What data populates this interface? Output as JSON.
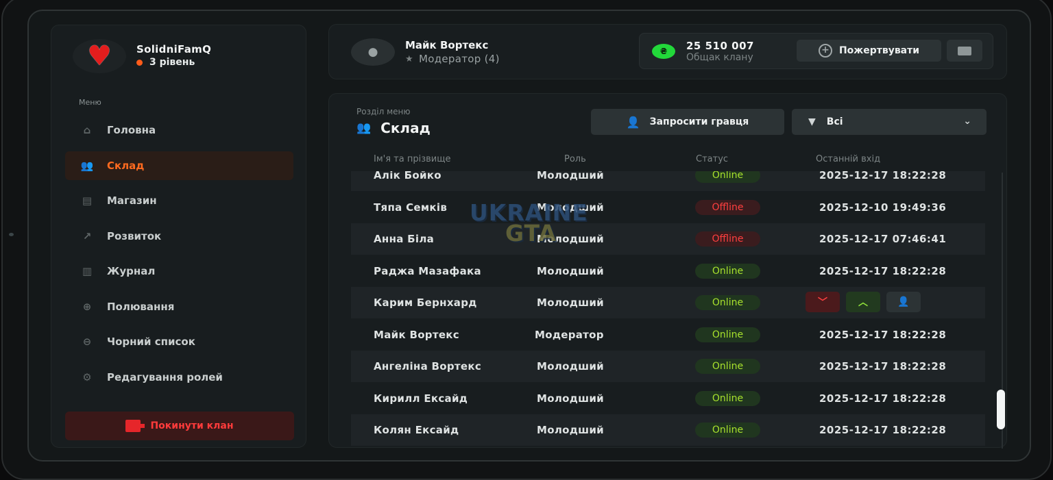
{
  "clan": {
    "name": "SolidniFamQ",
    "level": "3 рівень",
    "avatar_icon": "heart-icon"
  },
  "menu": {
    "label": "Меню",
    "items": [
      {
        "label": "Головна",
        "icon": "home-icon"
      },
      {
        "label": "Склад",
        "icon": "users-icon",
        "active": true
      },
      {
        "label": "Магазин",
        "icon": "basket-icon"
      },
      {
        "label": "Розвиток",
        "icon": "chart-icon"
      },
      {
        "label": "Журнал",
        "icon": "book-icon"
      },
      {
        "label": "Полювання",
        "icon": "crosshair-icon"
      },
      {
        "label": "Чорний список",
        "icon": "block-icon"
      },
      {
        "label": "Редагування ролей",
        "icon": "user-gear-icon"
      }
    ],
    "leave": "Покинути клан"
  },
  "profile": {
    "name": "Майк Вортекс",
    "role": "Модератор (4)"
  },
  "bank": {
    "amount": "25 510 007",
    "label": "Общак клану",
    "donate": "Пожертвувати",
    "coin_symbol": "₴"
  },
  "section": {
    "label": "Розділ меню",
    "title": "Склад"
  },
  "actions": {
    "invite": "Запросити гравця",
    "filter": "Всі"
  },
  "table": {
    "headers": {
      "name": "Ім'я та прізвище",
      "role": "Роль",
      "status": "Статус",
      "last_login": "Останній вхід"
    },
    "rows": [
      {
        "name": "Алік Бойко",
        "role": "Молодший",
        "status": "Online",
        "date": "2025-12-17 18:22:28"
      },
      {
        "name": "Тяпа Семків",
        "role": "Молодший",
        "status": "Offline",
        "date": "2025-12-10 19:49:36"
      },
      {
        "name": "Анна Біла",
        "role": "Молодший",
        "status": "Offline",
        "date": "2025-12-17 07:46:41"
      },
      {
        "name": "Раджа Мазафака",
        "role": "Молодший",
        "status": "Online",
        "date": "2025-12-17 18:22:28"
      },
      {
        "name": "Карим Бернхард",
        "role": "Молодший",
        "status": "Online",
        "date": ""
      },
      {
        "name": "Майк Вортекс",
        "role": "Модератор",
        "status": "Online",
        "date": "2025-12-17 18:22:28"
      },
      {
        "name": "Ангеліна Вортекс",
        "role": "Молодший",
        "status": "Online",
        "date": "2025-12-17 18:22:28"
      },
      {
        "name": "Кирилл Ексайд",
        "role": "Молодший",
        "status": "Online",
        "date": "2025-12-17 18:22:28"
      },
      {
        "name": "Колян Ексайд",
        "role": "Молодший",
        "status": "Online",
        "date": "2025-12-17 18:22:28"
      }
    ]
  },
  "watermark": {
    "line1": "UKRAINE",
    "line2": "GTA"
  },
  "colors": {
    "accent": "#ff6a1f",
    "online": "#a8e22d",
    "offline": "#ff3f3f",
    "coin": "#22d83a"
  }
}
